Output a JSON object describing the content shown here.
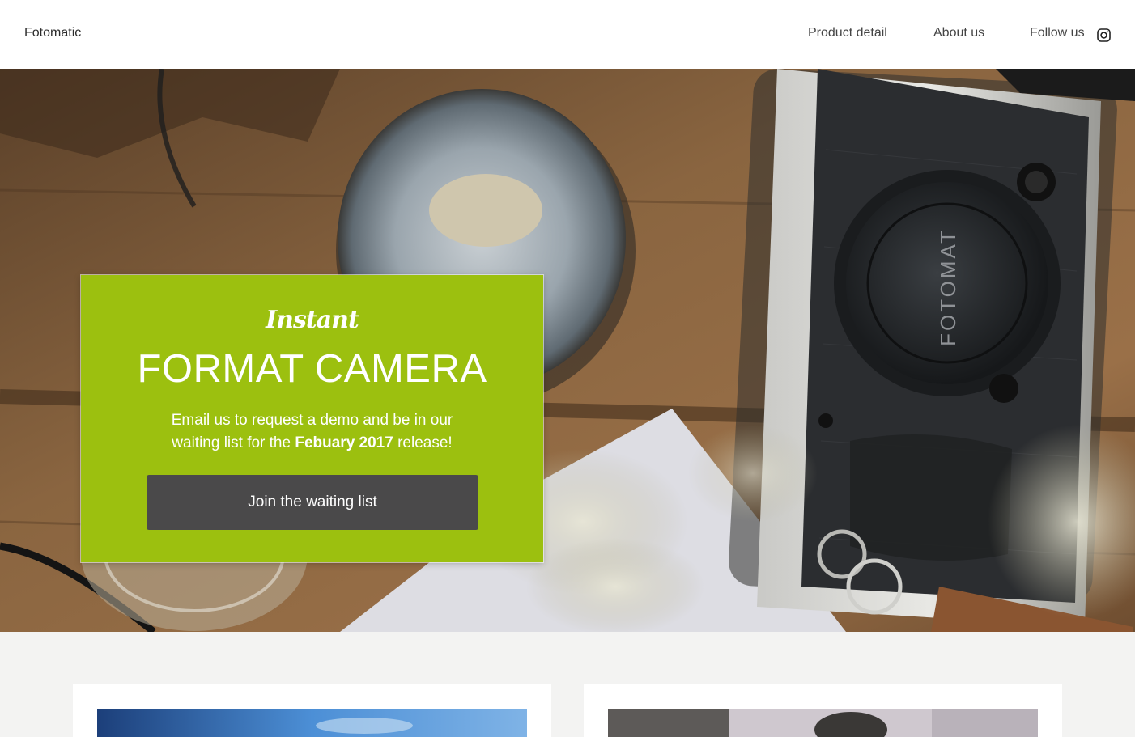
{
  "header": {
    "brand": "Fotomatic",
    "nav": {
      "product_detail": "Product detail",
      "about_us": "About us",
      "follow_us": "Follow us"
    },
    "social_icon": "instagram-icon"
  },
  "hero": {
    "background": "camera-on-wooden-table-photo",
    "camera_brand_text": "FOTOMAT",
    "card": {
      "script_title": "Instant",
      "title": "FORMAT CAMERA",
      "text_part1": "Email us to request a demo and be in our waiting list for the ",
      "text_bold": "Febuary 2017",
      "text_part2": " release!",
      "button_label": "Join the waiting list"
    }
  },
  "colors": {
    "accent_green": "#9cc00f",
    "button_dark": "#4a494a",
    "section_bg": "#f3f3f2"
  }
}
